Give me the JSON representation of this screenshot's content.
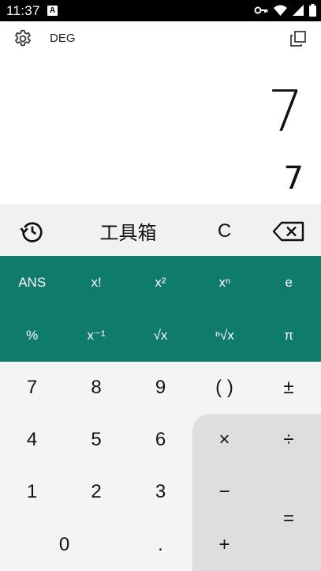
{
  "status": {
    "time": "11:37",
    "badge": "A"
  },
  "header": {
    "mode": "DEG"
  },
  "display": {
    "expression": "7",
    "result": "7"
  },
  "toolbar": {
    "toolbox_label": "工具箱",
    "clear_label": "C"
  },
  "scientific": {
    "row1": [
      "ANS",
      "x!",
      "x²",
      "xⁿ",
      "e"
    ],
    "row2": [
      "%",
      "x⁻¹",
      "√x",
      "ⁿ√x",
      "π"
    ]
  },
  "keypad": {
    "k7": "7",
    "k8": "8",
    "k9": "9",
    "paren": "( )",
    "plusminus": "±",
    "k4": "4",
    "k5": "5",
    "k6": "6",
    "multiply": "×",
    "divide": "÷",
    "k1": "1",
    "k2": "2",
    "k3": "3",
    "minus": "−",
    "equals": "=",
    "k0": "0",
    "dot": ".",
    "plus": "+"
  },
  "colors": {
    "scientific_bg": "#0e7b6b",
    "keypad_bg": "#f4f4f4",
    "operator_bg": "#dedede"
  }
}
